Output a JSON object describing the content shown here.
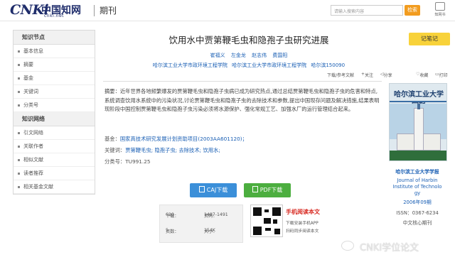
{
  "header": {
    "logo_text": "CNKi",
    "logo_cn": "中国知网",
    "logo_url": "cnki.net",
    "section": "期刊",
    "search_placeholder": "请输入搜索内容",
    "search_button": "检索",
    "app_label": "知网书"
  },
  "sidebar": {
    "groups": [
      {
        "title": "知识节点",
        "items": [
          "基本信息",
          "摘要",
          "基金",
          "关键词",
          "分类号"
        ]
      },
      {
        "title": "知识网络",
        "items": [
          "引文网络",
          "关联作者",
          "相似文献",
          "读者推荐",
          "相关基金文献"
        ]
      }
    ]
  },
  "article": {
    "title": "饮用水中贾第鞭毛虫和隐孢子虫研究进展",
    "authors": "崔福义  左金龙  赵志伟  费国阳",
    "orgs": "哈尔滨工业大学市政环境工程学院   哈尔滨工业大学市政环境工程学院   哈尔滨150090",
    "note_button": "记笔记",
    "tools": {
      "share_text": "下载/参考文献",
      "follow": "关注",
      "share": "分享",
      "favorite": "收藏",
      "print": "打印"
    },
    "abstract_label": "摘要：",
    "abstract": "近年世界各地频繁爆发的贾第鞭毛虫和隐孢子虫病已成为研究热点,通过总结贾第鞭毛虫和隐孢子虫的危害和特点,系统调查饮用水系统中的污染状况,讨论贾第鞭毛虫和隐孢子虫的去除技术和参数,提出中国现存问题及解决措施,结果表明现阶段中国控制贾第鞭毛虫和隐孢子虫污染必须将水源保护、强化常规工艺、加强水厂的运行管理结合起来。",
    "fund_label": "基金：",
    "fund": "国家高技术研究发展计划资助项目(2003AA601120)；",
    "keywords_label": "关键词：",
    "keywords": [
      "贾第鞭毛虫;",
      "隐孢子虫;",
      "去除技术;",
      "饮用水;"
    ],
    "class_label": "分类号：",
    "class_no": "TU991.25"
  },
  "journal": {
    "cover_title": "哈尔滨工业大学学报",
    "name_cn": "哈尔滨工业大学学报",
    "name_en_1": "Journal of Harbin",
    "name_en_2": "Institute of Technolo",
    "name_en_3": "gy",
    "issue": "2006年09期",
    "issn": "ISSN：0367-6234",
    "core": "中文核心期刊"
  },
  "downloads": {
    "caj": "CAJ下载",
    "pdf": "PDF下载"
  },
  "stats": {
    "downloads_label": "下载：",
    "downloads": "620",
    "pages_label": "页码：",
    "pages": "1487-1491",
    "page_count_label": "页数：",
    "page_count": "5",
    "size_label": "大小：",
    "size": "154K"
  },
  "mobile": {
    "title": "手机阅读本文",
    "line1": "下载安装手机APP",
    "line2": "扫码同步阅读本文"
  },
  "watermark": "CNKI学位论文",
  "colors": {
    "accent_blue": "#1a5fb4",
    "search_orange": "#f29c1f",
    "note_yellow": "#f8d23a",
    "caj_blue": "#3b8fd9",
    "pdf_green": "#4cae3f",
    "mobile_red": "#d7261e"
  }
}
